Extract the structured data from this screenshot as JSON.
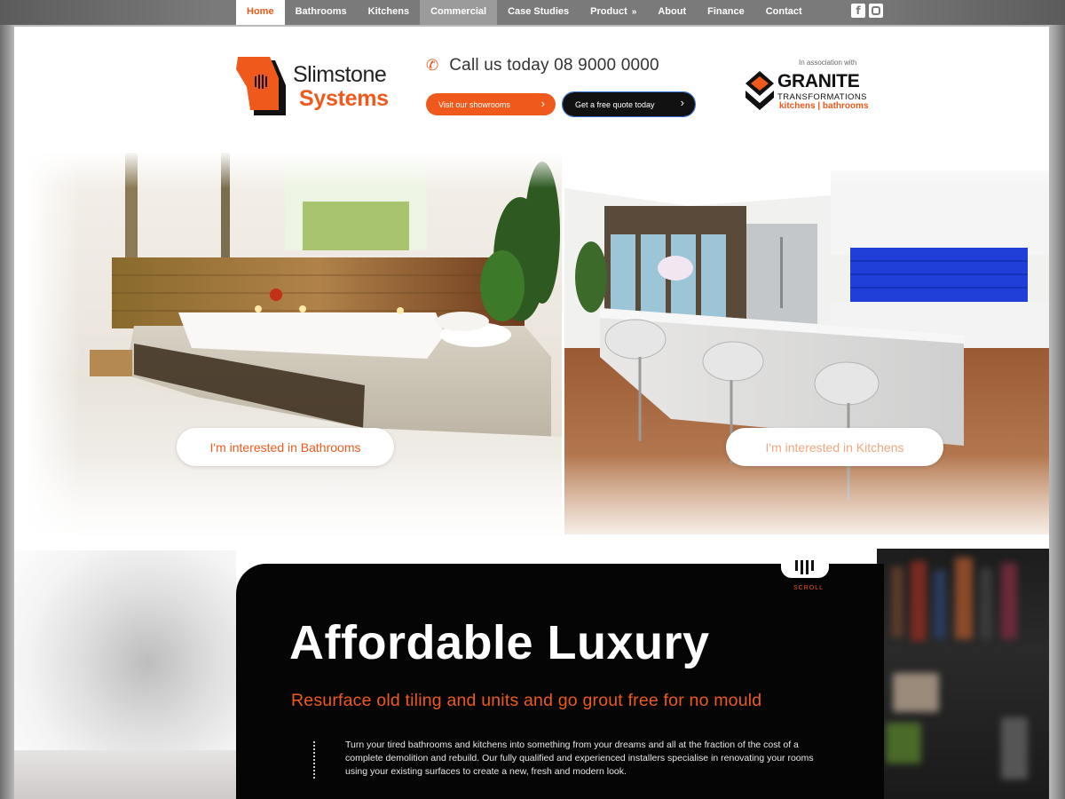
{
  "nav": {
    "items": [
      {
        "label": "Home",
        "state": "active"
      },
      {
        "label": "Bathrooms",
        "state": ""
      },
      {
        "label": "Kitchens",
        "state": ""
      },
      {
        "label": "Commercial",
        "state": "highlight"
      },
      {
        "label": "Case Studies",
        "state": ""
      },
      {
        "label": "Product",
        "state": "dropdown"
      },
      {
        "label": "About",
        "state": ""
      },
      {
        "label": "Finance",
        "state": ""
      },
      {
        "label": "Contact",
        "state": ""
      }
    ],
    "product_chevron": "»",
    "social": [
      {
        "icon": "facebook-icon",
        "glyph": "f"
      },
      {
        "icon": "instagram-icon",
        "glyph": ""
      }
    ]
  },
  "header": {
    "logo_line1": "Slimstone",
    "logo_line2": "Systems",
    "phone_text": "Call us today 08 9000 0000",
    "showroom_button": "Visit our showrooms",
    "quote_button": "Get a free quote today",
    "button_arrow": "›",
    "assoc_caption": "In association with",
    "assoc_brand": "GRANITE",
    "assoc_sub": "TRANSFORMATIONS",
    "assoc_tag": "kitchens  |  bathrooms"
  },
  "hero": {
    "bathrooms_cta": "I'm interested in Bathrooms",
    "kitchens_cta": "I'm interested in Kitchens"
  },
  "feature": {
    "scroll_label": "SCROLL",
    "title": "Affordable Luxury",
    "subtitle": "Resurface old tiling and units and go grout free for no mould",
    "body": "Turn your tired bathrooms and kitchens into something from your dreams and all at the fraction of the cost of a complete demolition and rebuild. Our fully qualified and experienced installers specialise in renovating your rooms using your existing surfaces to create a new, fresh and modern look."
  },
  "colors": {
    "accent": "#ef5a1c",
    "nav_bg": "#7a7a7a",
    "dark_panel": "#050505",
    "kitchen_splashback": "#1f3fd8"
  }
}
